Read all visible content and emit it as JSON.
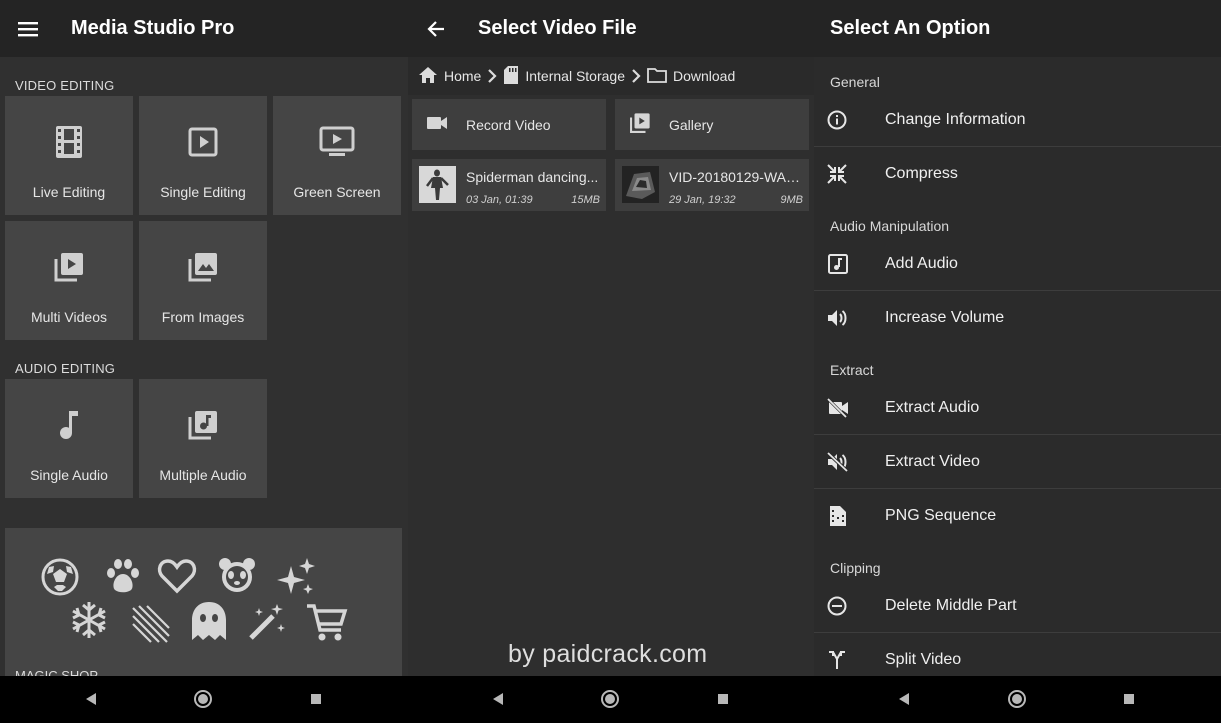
{
  "pane1": {
    "title": "Media Studio Pro",
    "video_section": "VIDEO EDITING",
    "video_tiles": [
      {
        "label": "Live Editing",
        "icon": "film-icon"
      },
      {
        "label": "Single Editing",
        "icon": "play-box-icon"
      },
      {
        "label": "Green Screen",
        "icon": "tv-play-icon"
      },
      {
        "label": "Multi Videos",
        "icon": "video-library-icon"
      },
      {
        "label": "From Images",
        "icon": "image-library-icon"
      }
    ],
    "audio_section": "AUDIO EDITING",
    "audio_tiles": [
      {
        "label": "Single Audio",
        "icon": "music-note-icon"
      },
      {
        "label": "Multiple Audio",
        "icon": "music-library-icon"
      }
    ],
    "magic_label": "MAGIC SHOP"
  },
  "pane2": {
    "title": "Select Video File",
    "breadcrumb": [
      "Home",
      "Internal Storage",
      "Download"
    ],
    "actions": [
      {
        "label": "Record Video",
        "icon": "videocam-icon"
      },
      {
        "label": "Gallery",
        "icon": "video-library-icon"
      }
    ],
    "files": [
      {
        "name": "Spiderman dancing...",
        "date": "03 Jan, 01:39",
        "size": "15MB"
      },
      {
        "name": "VID-20180129-WA0...",
        "date": "29 Jan, 19:32",
        "size": "9MB"
      }
    ],
    "watermark": "by paidcrack.com"
  },
  "pane3": {
    "title": "Select An Option",
    "groups": [
      {
        "label": "General",
        "options": [
          {
            "label": "Change Information",
            "icon": "info-icon"
          },
          {
            "label": "Compress",
            "icon": "compress-icon"
          }
        ]
      },
      {
        "label": "Audio Manipulation",
        "options": [
          {
            "label": "Add Audio",
            "icon": "audio-file-icon"
          },
          {
            "label": "Increase Volume",
            "icon": "volume-up-icon"
          }
        ]
      },
      {
        "label": "Extract",
        "options": [
          {
            "label": "Extract Audio",
            "icon": "videocam-off-icon"
          },
          {
            "label": "Extract Video",
            "icon": "volume-off-icon"
          },
          {
            "label": "PNG Sequence",
            "icon": "image-sequence-icon"
          }
        ]
      },
      {
        "label": "Clipping",
        "options": [
          {
            "label": "Delete Middle Part",
            "icon": "remove-circle-icon"
          },
          {
            "label": "Split Video",
            "icon": "split-icon"
          }
        ]
      }
    ]
  },
  "colors": {
    "appbar": "#242424",
    "tile": "#454545",
    "background": "#303030"
  }
}
